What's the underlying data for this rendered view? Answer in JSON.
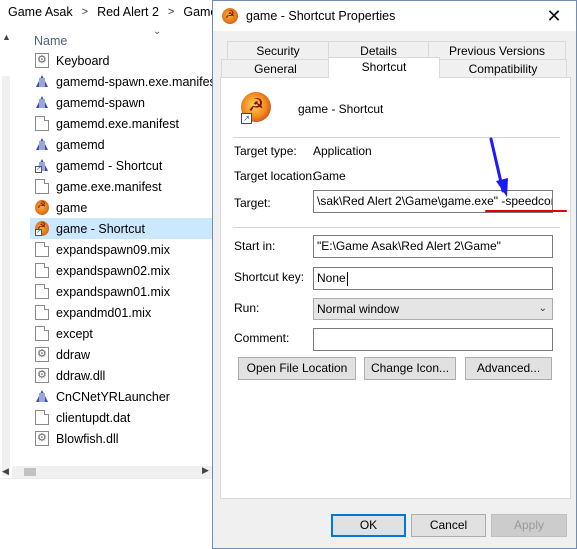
{
  "explorer": {
    "breadcrumb": [
      "Game Asak",
      "Red Alert 2",
      "Game"
    ],
    "column_header": "Name",
    "files": [
      {
        "name": "Keyboard",
        "icon": "settings-file-icon",
        "selected": false
      },
      {
        "name": "gamemd-spawn.exe.manifest",
        "icon": "exe-icon",
        "selected": false
      },
      {
        "name": "gamemd-spawn",
        "icon": "exe-icon",
        "selected": false
      },
      {
        "name": "gamemd.exe.manifest",
        "icon": "document-icon",
        "selected": false
      },
      {
        "name": "gamemd",
        "icon": "exe-icon",
        "selected": false
      },
      {
        "name": "gamemd - Shortcut",
        "icon": "exe-shortcut-icon",
        "selected": false
      },
      {
        "name": "game.exe.manifest",
        "icon": "document-icon",
        "selected": false
      },
      {
        "name": "game",
        "icon": "red-alert-icon",
        "selected": false
      },
      {
        "name": "game - Shortcut",
        "icon": "red-alert-shortcut-icon",
        "selected": true
      },
      {
        "name": "expandspawn09.mix",
        "icon": "document-icon",
        "selected": false
      },
      {
        "name": "expandspawn02.mix",
        "icon": "document-icon",
        "selected": false
      },
      {
        "name": "expandspawn01.mix",
        "icon": "document-icon",
        "selected": false
      },
      {
        "name": "expandmd01.mix",
        "icon": "document-icon",
        "selected": false
      },
      {
        "name": "except",
        "icon": "document-icon",
        "selected": false
      },
      {
        "name": "ddraw",
        "icon": "settings-file-icon",
        "selected": false
      },
      {
        "name": "ddraw.dll",
        "icon": "settings-file-icon",
        "selected": false
      },
      {
        "name": "CnCNetYRLauncher",
        "icon": "exe-icon",
        "selected": false
      },
      {
        "name": "clientupdt.dat",
        "icon": "document-icon",
        "selected": false
      },
      {
        "name": "Blowfish.dll",
        "icon": "settings-file-icon",
        "selected": false
      }
    ]
  },
  "dialog": {
    "title": "game - Shortcut Properties",
    "close_glyph": "✕",
    "tabs_row1": [
      "Security",
      "Details",
      "Previous Versions"
    ],
    "tabs_row2": [
      "General",
      "Shortcut",
      "Compatibility"
    ],
    "active_tab": "Shortcut",
    "shortcut_name": "game - Shortcut",
    "target_type_label": "Target type:",
    "target_type_value": "Application",
    "target_location_label": "Target location:",
    "target_location_value": "Game",
    "target_label": "Target:",
    "target_value_main": "\\sak\\Red Alert 2\\Game\\game.exe\"",
    "target_value_arg": "-speedcontrol",
    "start_in_label": "Start in:",
    "start_in_value": "\"E:\\Game Asak\\Red Alert 2\\Game\"",
    "shortcut_key_label": "Shortcut key:",
    "shortcut_key_value": "None",
    "run_label": "Run:",
    "run_value": "Normal window",
    "comment_label": "Comment:",
    "comment_value": "",
    "buttons": {
      "open_file_location": "Open File Location",
      "change_icon": "Change Icon...",
      "advanced": "Advanced...",
      "ok": "OK",
      "cancel": "Cancel",
      "apply": "Apply"
    },
    "annotation_colors": {
      "underline": "#e00000",
      "arrow": "#1a1aff"
    }
  }
}
